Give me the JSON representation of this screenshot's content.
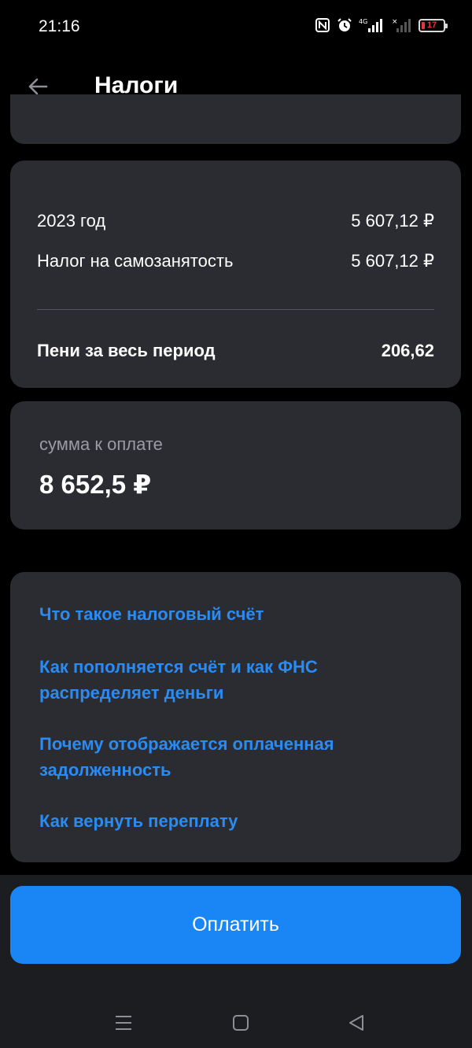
{
  "status_bar": {
    "time": "21:16",
    "network": "4G",
    "battery": "17",
    "icons": [
      "nfc-icon",
      "alarm-icon",
      "signal-4g-icon",
      "signal-none-icon",
      "battery-icon"
    ]
  },
  "header": {
    "title": "Налоги",
    "back_icon": "arrow-left-icon"
  },
  "details": {
    "year_label": "2023 год",
    "year_amount": "5 607,12 ₽",
    "tax_label": "Налог на самозанятость",
    "tax_amount": "5 607,12 ₽",
    "penalty_label": "Пени за весь период",
    "penalty_amount": "206,62"
  },
  "summary": {
    "label": "сумма к оплате",
    "value": "8 652,5 ₽"
  },
  "help_links": [
    {
      "text": "Что такое налоговый счёт"
    },
    {
      "text": "Как пополняется счёт и как ФНС распределяет деньги"
    },
    {
      "text": "Почему отображается оплаченная задолженность"
    },
    {
      "text": "Как вернуть переплату"
    }
  ],
  "actions": {
    "pay_label": "Оплатить"
  },
  "nav": {
    "icons": [
      "menu-icon",
      "home-icon",
      "back-triangle-icon"
    ]
  },
  "colors": {
    "background": "#000000",
    "card": "#2b2c31",
    "link": "#2a8bf2",
    "primary_button": "#1a86f5",
    "battery_low": "#e53935"
  }
}
